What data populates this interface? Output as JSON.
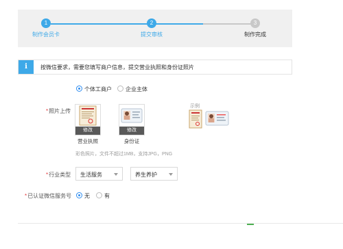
{
  "steps": [
    {
      "num": "1",
      "label": "制作会员卡",
      "state": "done"
    },
    {
      "num": "2",
      "label": "提交审核",
      "state": "active"
    },
    {
      "num": "3",
      "label": "制作完成",
      "state": "todo"
    }
  ],
  "notice": {
    "icon": "info-icon",
    "text": "按微信要求，需要您填写商户信息，提交营业执照和身份证照片"
  },
  "entity": {
    "options": [
      {
        "label": "个体工商户",
        "checked": true
      },
      {
        "label": "企业主体",
        "checked": false
      }
    ]
  },
  "photo": {
    "label": "照片上传",
    "items": [
      {
        "edit": "修改",
        "caption": "营业执照"
      },
      {
        "edit": "修改",
        "caption": "身份证"
      }
    ],
    "sample_label": "示例",
    "tip": "彩色照片，文件不超过1MB，支持JPG，PNG"
  },
  "industry": {
    "label": "行业类型",
    "primary": "生活服务",
    "secondary": "养生养护"
  },
  "verified": {
    "label": "已认证微信服务号",
    "options": [
      {
        "label": "无",
        "checked": true
      },
      {
        "label": "有",
        "checked": false
      }
    ]
  },
  "colors": {
    "accent": "#3ea9e8",
    "inactive": "#c8c8c8",
    "required": "#e4393c"
  }
}
